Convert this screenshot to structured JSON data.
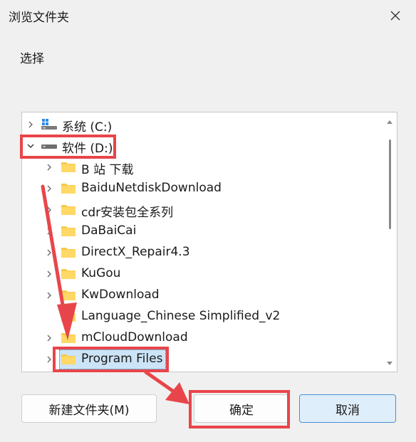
{
  "dialog": {
    "title": "浏览文件夹",
    "prompt": "选择"
  },
  "tree": {
    "items": [
      {
        "label": "系统 (C:)",
        "type": "drive",
        "expanded": false
      },
      {
        "label": "软件 (D:)",
        "type": "drive",
        "expanded": true
      },
      {
        "label": "B 站 下载",
        "type": "folder"
      },
      {
        "label": "BaiduNetdiskDownload",
        "type": "folder"
      },
      {
        "label": "cdr安装包全系列",
        "type": "folder"
      },
      {
        "label": "DaBaiCai",
        "type": "folder"
      },
      {
        "label": "DirectX_Repair4.3",
        "type": "folder"
      },
      {
        "label": "KuGou",
        "type": "folder"
      },
      {
        "label": "KwDownload",
        "type": "folder"
      },
      {
        "label": "Language_Chinese Simplified_v2",
        "type": "folder"
      },
      {
        "label": "mCloudDownload",
        "type": "folder"
      },
      {
        "label": "Program Files",
        "type": "folder",
        "selected": true
      }
    ]
  },
  "buttons": {
    "new_folder": "新建文件夹(M)",
    "ok": "确定",
    "cancel": "取消"
  },
  "colors": {
    "annotation": "#e8454a",
    "selection": "#cce4f7",
    "folder": "#f7c94a"
  }
}
